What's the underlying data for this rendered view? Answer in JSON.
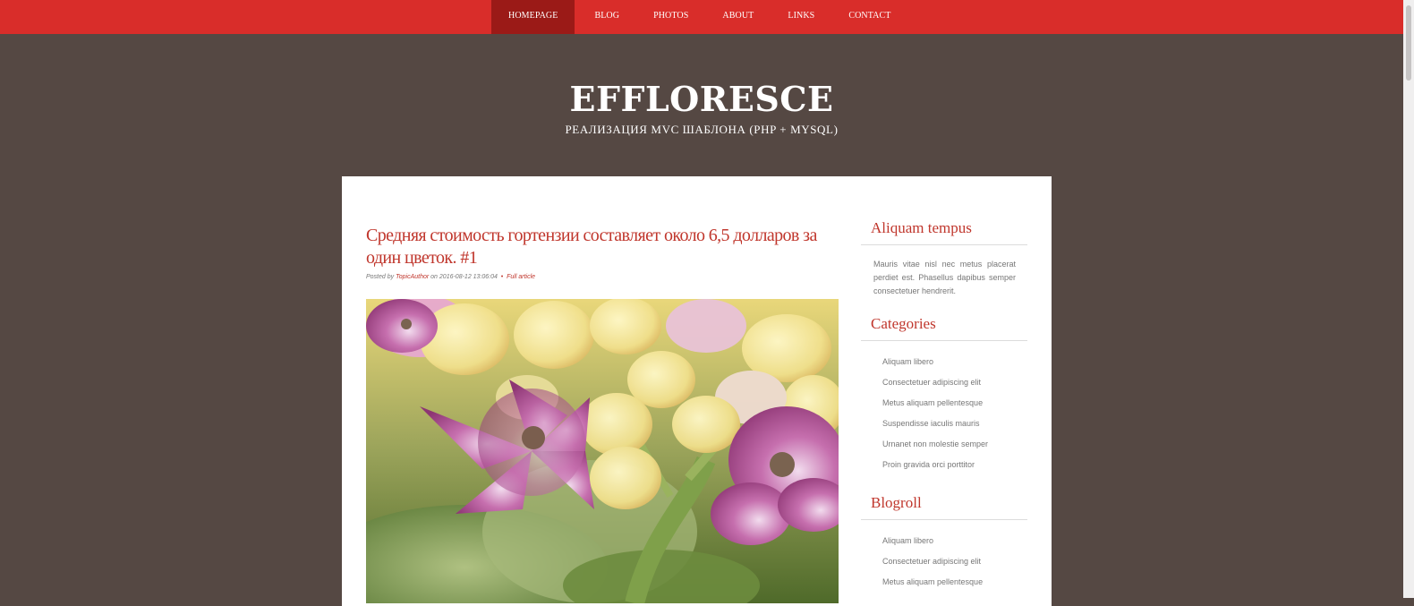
{
  "nav": {
    "items": [
      "HOMEPAGE",
      "BLOG",
      "PHOTOS",
      "ABOUT",
      "LINKS",
      "CONTACT"
    ],
    "active": "HOMEPAGE"
  },
  "header": {
    "title": "EFFLORESCE",
    "subtitle": "РЕАЛИЗАЦИЯ MVC ШАБЛОНА (PHP + MYSQL)"
  },
  "post": {
    "title": "Средняя стоимость гортензии составляет около 6,5 долларов за один цветок. #1",
    "meta": {
      "posted_by": "Posted by",
      "author": "TopicAuthor",
      "on": "on",
      "date": "2016-08-12 13:06:04",
      "separator": "•",
      "full_article": "Full article"
    }
  },
  "sidebar": {
    "about": {
      "title": "Aliquam tempus",
      "text": "Mauris vitae nisl nec metus placerat perdiet est. Phasellus dapibus semper consectetuer hendrerit."
    },
    "categories": {
      "title": "Categories",
      "items": [
        "Aliquam libero",
        "Consectetuer adipiscing elit",
        "Metus aliquam pellentesque",
        "Suspendisse iaculis mauris",
        "Urnanet non molestie semper",
        "Proin gravida orci porttitor"
      ]
    },
    "blogroll": {
      "title": "Blogroll",
      "items": [
        "Aliquam libero",
        "Consectetuer adipiscing elit",
        "Metus aliquam pellentesque"
      ]
    }
  },
  "colors": {
    "nav_bg": "#d92d2a",
    "nav_active_bg": "#9b1a17",
    "page_bg": "#554843",
    "accent": "#c0362c"
  }
}
